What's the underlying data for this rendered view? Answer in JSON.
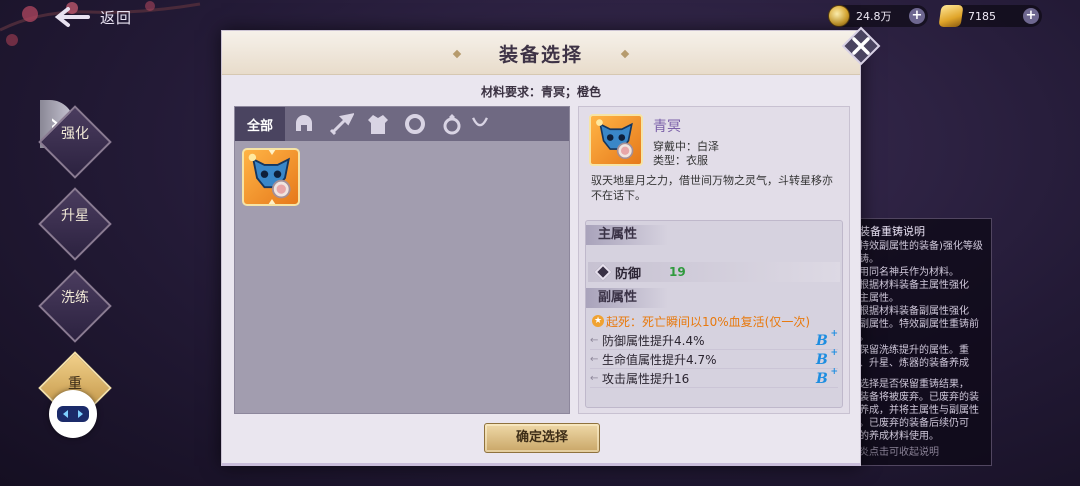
{
  "top_bar": {
    "back_label": "返回",
    "currencies": [
      {
        "icon": "coin-icon",
        "value": "24.8万"
      },
      {
        "icon": "gold-ingot-icon",
        "value": "7185"
      }
    ]
  },
  "side_menu": {
    "items": [
      {
        "label": "强化"
      },
      {
        "label": "升星"
      },
      {
        "label": "洗练"
      },
      {
        "label": "重"
      }
    ]
  },
  "help_panel": {
    "title": "装备重铸说明",
    "lines": [
      "特效副属性的装备)强化等级",
      "铸。",
      "用同名神兵作为材料。",
      "根据材料装备主属性强化",
      "主属性。",
      "根据材料装备副属性强化",
      "副属性。特效副属性重铸前",
      "。",
      "保留洗练提升的属性。重",
      "、升星、炼器的装备养成",
      "",
      "选择是否保留重铸结果，",
      "装备将被废弃。已废弃的装",
      "养成，并将主属性与副属性",
      "。已废弃的装备后续仍可",
      "的养成材料使用。"
    ],
    "footer": "炎点击可收起说明"
  },
  "modal": {
    "title": "装备选择",
    "requirement": "材料要求：青冥；橙色",
    "filter_tabs": [
      {
        "label": "全部",
        "icon": "all-tab"
      },
      {
        "icon": "helmet-icon"
      },
      {
        "icon": "weapon-icon"
      },
      {
        "icon": "armor-icon"
      },
      {
        "icon": "bracelet-icon"
      },
      {
        "icon": "ring-icon"
      },
      {
        "icon": "necklace-icon"
      }
    ],
    "detail": {
      "name": "青冥",
      "wearer": "穿戴中：白泽",
      "type": "类型：衣服",
      "description": "驭天地星月之力，借世间万物之灵气，斗转星移亦不在话下。",
      "main_header": "主属性",
      "main_attr": {
        "name": "防御",
        "value": "19"
      },
      "sub_header": "副属性",
      "special": "起死：死亡瞬间以10%血复活(仅一次)",
      "subs": [
        {
          "text": "防御属性提升4.4%",
          "grade": "B",
          "plus": "+"
        },
        {
          "text": "生命值属性提升4.7%",
          "grade": "B",
          "plus": "+"
        },
        {
          "text": "攻击属性提升16",
          "grade": "B",
          "plus": "+"
        }
      ]
    },
    "confirm_label": "确定选择"
  },
  "colors": {
    "accent_orange": "#e8790d",
    "value_green": "#2f9a3d",
    "grade_blue": "#1d8de0",
    "item_quality_orange": "#f29a2e"
  }
}
